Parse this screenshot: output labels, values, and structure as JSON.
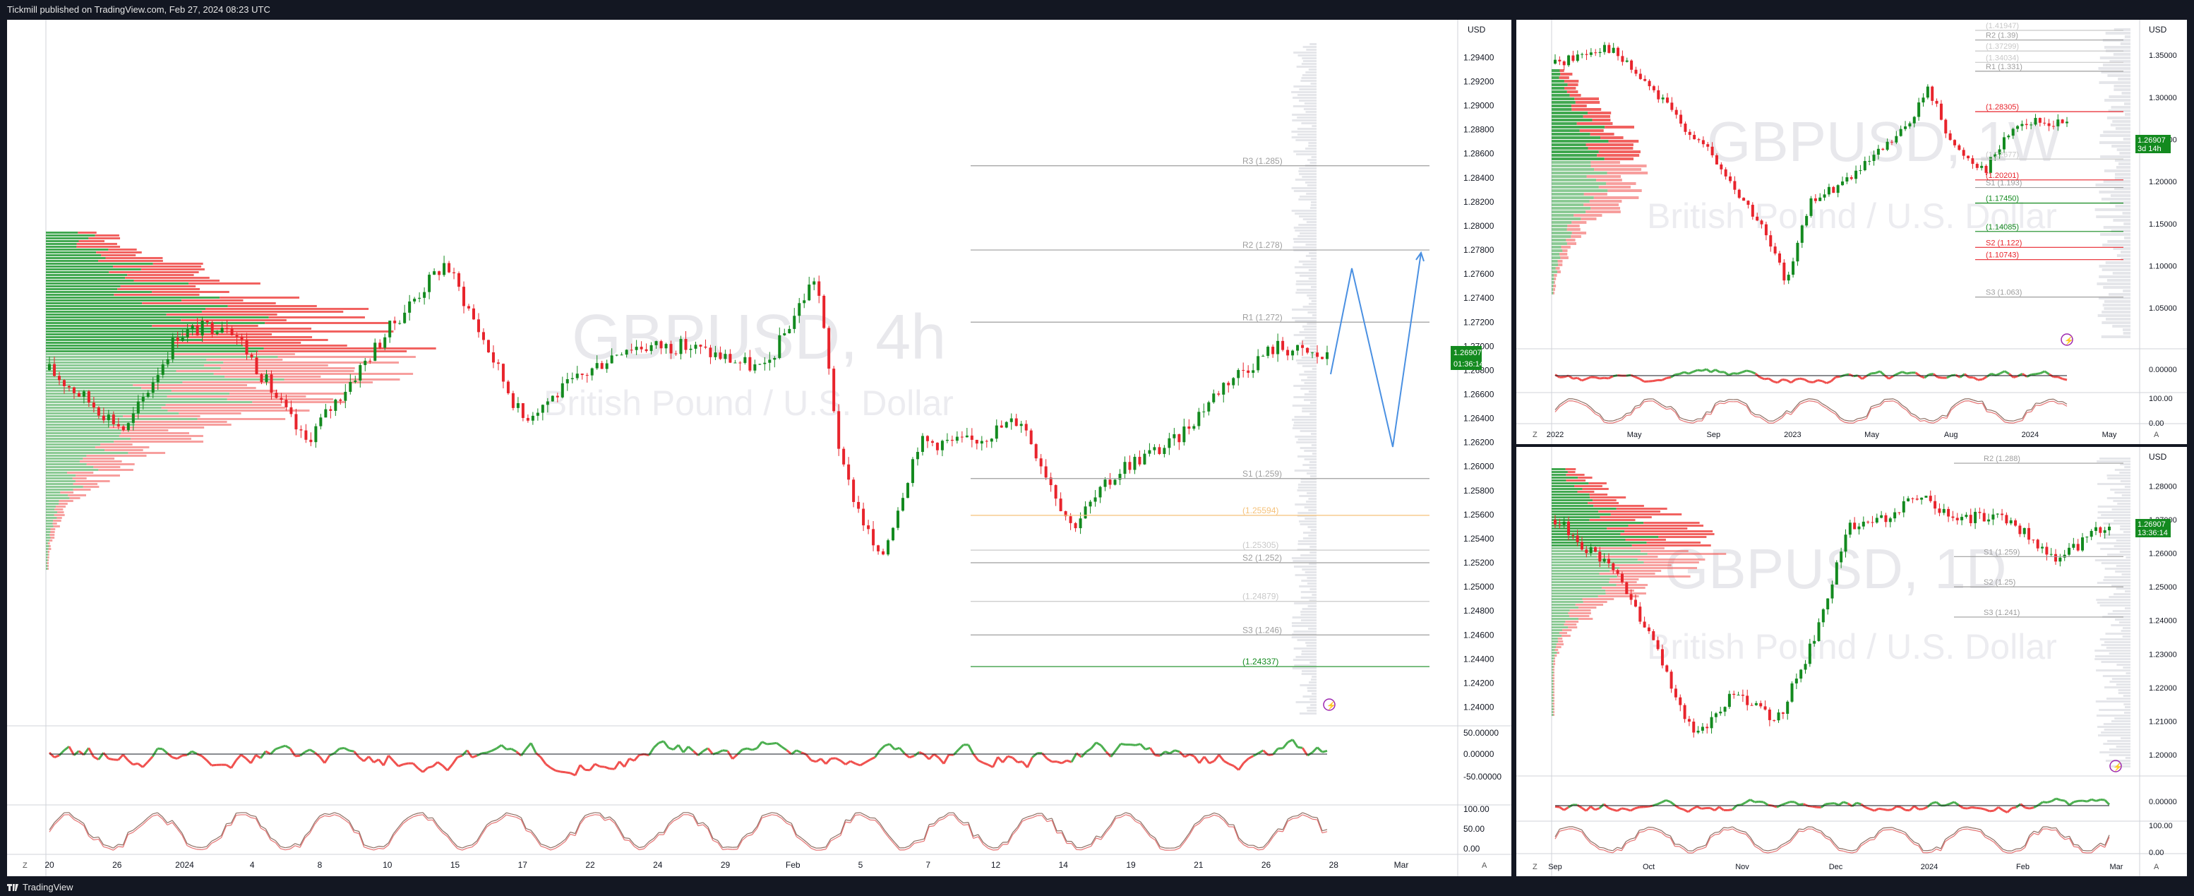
{
  "header": {
    "publish_text": "Tickmill published on TradingView.com, Feb 27, 2024 08:23 UTC"
  },
  "footer": {
    "brand": "TradingView"
  },
  "colors": {
    "up": "#138a1f",
    "down": "#e8242c",
    "orange": "#f5a623",
    "pivot": "#9e9e9e",
    "bg": "#ffffff",
    "price_label": "#138a1f"
  },
  "left_chart": {
    "currency": "USD",
    "watermark_symbol": "GBPUSD, 4h",
    "watermark_name": "British Pound / U.S. Dollar",
    "price_axis": [
      "1.29400",
      "1.29200",
      "1.29000",
      "1.28800",
      "1.28600",
      "1.28400",
      "1.28200",
      "1.28000",
      "1.27800",
      "1.27600",
      "1.27400",
      "1.27200",
      "1.27000",
      "1.26800",
      "1.26600",
      "1.26400",
      "1.26200",
      "1.26000",
      "1.25800",
      "1.25600",
      "1.25400",
      "1.25200",
      "1.25000",
      "1.24800",
      "1.24600",
      "1.24400",
      "1.24200",
      "1.24000"
    ],
    "price_range": [
      1.2395,
      1.2952
    ],
    "last_price": "1.26907",
    "countdown": "01:36:14",
    "pivots": [
      {
        "label": "R3 (1.285)",
        "value": 1.285,
        "color": "#9e9e9e"
      },
      {
        "label": "R2 (1.278)",
        "value": 1.278,
        "color": "#9e9e9e"
      },
      {
        "label": "R1 (1.272)",
        "value": 1.272,
        "color": "#9e9e9e"
      },
      {
        "label": "S1 (1.259)",
        "value": 1.259,
        "color": "#9e9e9e"
      },
      {
        "label": "S2 (1.252)",
        "value": 1.252,
        "color": "#9e9e9e"
      },
      {
        "label": "S3 (1.246)",
        "value": 1.246,
        "color": "#9e9e9e"
      }
    ],
    "levels": [
      {
        "label": "(1.24337)",
        "value": 1.24337,
        "color": "#138a1f"
      },
      {
        "label": "(1.24879)",
        "value": 1.24879,
        "color": "#c8c8c8"
      },
      {
        "label": "(1.25305)",
        "value": 1.25305,
        "color": "#c8c8c8"
      },
      {
        "label": "(1.25594)",
        "value": 1.25594,
        "color": "#f5c27a"
      }
    ],
    "rsi_axis": [
      "50.00000",
      "0.00000",
      "-50.00000"
    ],
    "stoch_axis": [
      "100.00",
      "50.00",
      "0.00"
    ],
    "time_axis": [
      "20",
      "26",
      "2024",
      "4",
      "8",
      "10",
      "15",
      "17",
      "22",
      "24",
      "29",
      "Feb",
      "5",
      "7",
      "12",
      "14",
      "19",
      "21",
      "26",
      "28",
      "Mar"
    ],
    "corner_left": "Z",
    "corner_right": "A"
  },
  "right_top_chart": {
    "currency": "USD",
    "watermark_symbol": "GBPUSD, 1W",
    "watermark_name": "British Pound / U.S. Dollar",
    "price_axis": [
      "1.35000",
      "1.30000",
      "1.25000",
      "1.20000",
      "1.15000",
      "1.10000",
      "1.05000"
    ],
    "price_range": [
      1.015,
      1.382
    ],
    "last_price": "1.26907",
    "countdown": "3d 14h",
    "pivots": [
      {
        "label": "(1.41947)",
        "value": 1.3795,
        "color": "#c8c8c8"
      },
      {
        "label": "R2 (1.39)",
        "value": 1.368,
        "color": "#9e9e9e"
      },
      {
        "label": "(1.37299)",
        "value": 1.355,
        "color": "#c8c8c8"
      },
      {
        "label": "(1.34034)",
        "value": 1.3415,
        "color": "#c8c8c8"
      },
      {
        "label": "R1 (1.331)",
        "value": 1.331,
        "color": "#9e9e9e"
      },
      {
        "label": "(1.28305)",
        "value": 1.28305,
        "color": "#e8242c"
      },
      {
        "label": "(1.22677)",
        "value": 1.22677,
        "color": "#c8c8c8"
      },
      {
        "label": "(1.20201)",
        "value": 1.20201,
        "color": "#e8242c"
      },
      {
        "label": "S1 (1.193)",
        "value": 1.193,
        "color": "#9e9e9e"
      },
      {
        "label": "(1.17450)",
        "value": 1.1745,
        "color": "#138a1f"
      },
      {
        "label": "(1.14085)",
        "value": 1.14085,
        "color": "#138a1f"
      },
      {
        "label": "S2 (1.122)",
        "value": 1.122,
        "color": "#e8242c"
      },
      {
        "label": "(1.10743)",
        "value": 1.10743,
        "color": "#e8242c"
      },
      {
        "label": "S3 (1.063)",
        "value": 1.063,
        "color": "#9e9e9e"
      }
    ],
    "rsi_axis": [
      "0.00000"
    ],
    "stoch_axis": [
      "100.00",
      "0.00"
    ],
    "time_axis": [
      "2022",
      "May",
      "Sep",
      "2023",
      "May",
      "Aug",
      "2024",
      "May"
    ],
    "corner_left": "Z",
    "corner_right": "A"
  },
  "right_bottom_chart": {
    "currency": "USD",
    "watermark_symbol": "GBPUSD, 1D",
    "watermark_name": "British Pound / U.S. Dollar",
    "price_axis": [
      "1.28000",
      "1.27000",
      "1.26000",
      "1.25000",
      "1.24000",
      "1.23000",
      "1.22000",
      "1.21000",
      "1.20000"
    ],
    "price_range": [
      1.196,
      1.2885
    ],
    "last_price": "1.26907",
    "countdown": "13:36:14",
    "pivots": [
      {
        "label": "R2 (1.288)",
        "value": 1.2868,
        "color": "#9e9e9e"
      },
      {
        "label": "S1 (1.259)",
        "value": 1.259,
        "color": "#9e9e9e"
      },
      {
        "label": "S2 (1.25)",
        "value": 1.25,
        "color": "#9e9e9e"
      },
      {
        "label": "S3 (1.241)",
        "value": 1.241,
        "color": "#9e9e9e"
      }
    ],
    "rsi_axis": [
      "0.00000"
    ],
    "stoch_axis": [
      "100.00",
      "0.00"
    ],
    "time_axis": [
      "Sep",
      "Oct",
      "Nov",
      "Dec",
      "2024",
      "Feb",
      "Mar"
    ],
    "corner_left": "Z",
    "corner_right": "A"
  }
}
